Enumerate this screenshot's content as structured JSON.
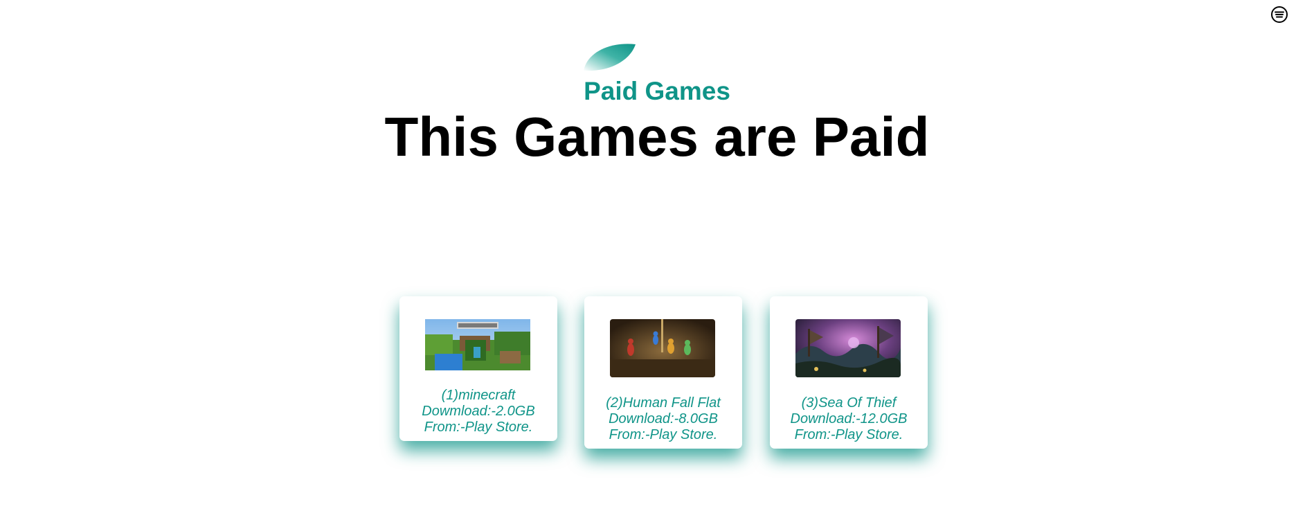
{
  "header": {
    "subtitle": "Paid Games",
    "title": "This Games are Paid",
    "menu_icon": "menu-circle-icon",
    "leaf_icon": "leaf-icon"
  },
  "colors": {
    "accent": "#0f9488",
    "title": "#000000",
    "background": "#ffffff"
  },
  "cards": [
    {
      "name": "(1)minecraft",
      "download": "Dowmload:-2.0GB",
      "source": "From:-Play Store.",
      "image": "minecraft-thumbnail"
    },
    {
      "name": "(2)Human Fall Flat",
      "download": "Download:-8.0GB",
      "source": "From:-Play Store.",
      "image": "human-fall-flat-thumbnail"
    },
    {
      "name": "(3)Sea Of Thief",
      "download": "Download:-12.0GB",
      "source": "From:-Play Store.",
      "image": "sea-of-thieves-thumbnail"
    }
  ]
}
